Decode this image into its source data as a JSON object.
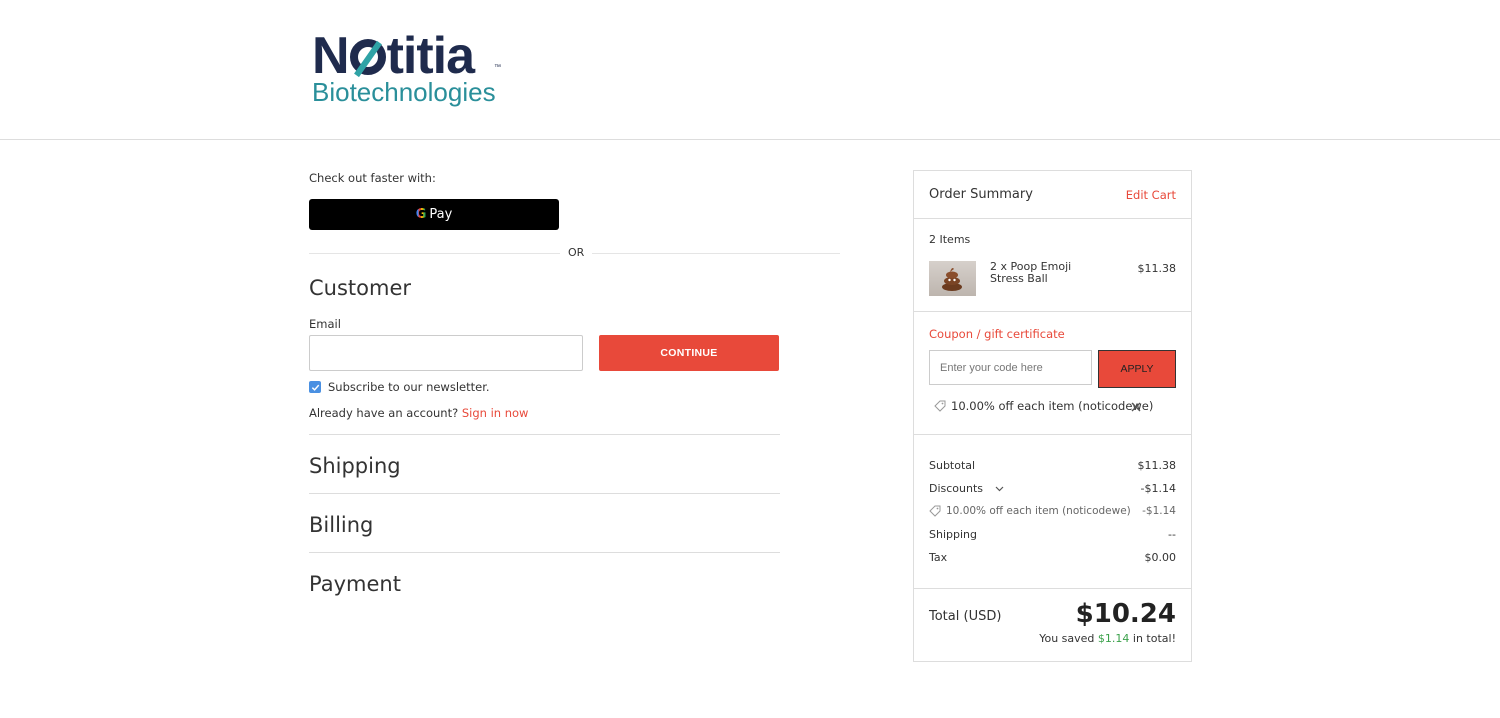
{
  "brand": {
    "logo_word_top": "Notitia",
    "logo_word_bottom": "Biotechnologies",
    "tm": "™"
  },
  "express": {
    "label": "Check out faster with:",
    "gpay_g": "G",
    "gpay_text": "Pay",
    "or": "OR"
  },
  "customer": {
    "heading": "Customer",
    "email_label": "Email",
    "email_value": "",
    "continue_label": "CONTINUE",
    "newsletter_label": "Subscribe to our newsletter.",
    "newsletter_checked": true,
    "already_text": "Already have an account?",
    "sign_in_label": "Sign in now"
  },
  "steps": {
    "shipping": "Shipping",
    "billing": "Billing",
    "payment": "Payment"
  },
  "summary": {
    "title": "Order Summary",
    "edit_cart": "Edit Cart",
    "items_count": "2 Items",
    "items": [
      {
        "name": "2 x Poop Emoji Stress Ball",
        "price": "$11.38"
      }
    ],
    "coupon_link": "Coupon / gift certificate",
    "coupon_placeholder": "Enter your code here",
    "apply_label": "APPLY",
    "applied_coupon": "10.00% off each item (noticodewe)",
    "lines": {
      "subtotal_label": "Subtotal",
      "subtotal_value": "$11.38",
      "discounts_label": "Discounts",
      "discounts_value": "-$1.14",
      "discount_detail_label": "10.00% off each item (noticodewe)",
      "discount_detail_value": "-$1.14",
      "shipping_label": "Shipping",
      "shipping_value": "--",
      "tax_label": "Tax",
      "tax_value": "$0.00"
    },
    "total_label": "Total (USD)",
    "total_value": "$10.24",
    "saved_prefix": "You saved",
    "saved_amount": "$1.14",
    "saved_suffix": "in total!"
  },
  "colors": {
    "accent": "#e8493a",
    "brand_navy": "#1f2b4d",
    "brand_teal": "#2a8f9a",
    "savings": "#3aa14a"
  }
}
